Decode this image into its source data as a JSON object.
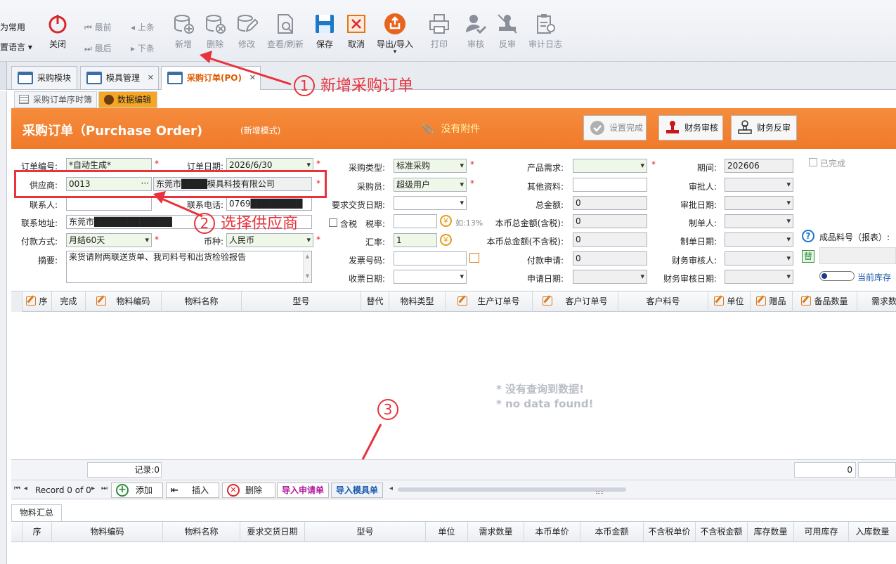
{
  "toolbar": {
    "left_top": "为常用",
    "left_bottom": "置语言",
    "close": "关闭",
    "first": "最前",
    "last": "最后",
    "prev": "上条",
    "next": "下条",
    "add": "新增",
    "delete": "删除",
    "edit": "修改",
    "view_refresh": "查看/刷新",
    "save": "保存",
    "cancel": "取消",
    "export_import": "导出/导入",
    "print": "打印",
    "audit": "审核",
    "unaudit": "反审",
    "audit_log": "审计日志"
  },
  "tabs": [
    {
      "label": "采购模块"
    },
    {
      "label": "模具管理"
    },
    {
      "label": "采购订单(PO)"
    }
  ],
  "subtabs": [
    {
      "label": "采购订单序时簿"
    },
    {
      "label": "数据编辑"
    }
  ],
  "header": {
    "title": "采购订单（Purchase Order)",
    "mode": "(新增模式)",
    "attachment": "没有附件",
    "set_done": "设置完成",
    "fin_audit": "财务审核",
    "fin_unaudit": "财务反审"
  },
  "form": {
    "order_no_label": "订单编号:",
    "order_no": "*自动生成*",
    "order_date_label": "订单日期:",
    "order_date": "2026/6/30",
    "supplier_label": "供应商:",
    "supplier_code": "0013",
    "supplier_name": "东莞市████模具科技有限公司",
    "contact_label": "联系人:",
    "phone_label": "联系电话:",
    "phone": "0769████████",
    "address_label": "联系地址:",
    "address": "东莞市████████████",
    "pay_label": "付款方式:",
    "pay": "月结60天",
    "currency_label": "币种:",
    "currency": "人民币",
    "memo_label": "摘要:",
    "memo": "来货请附两联送货单、我司料号和出货检验报告",
    "ptype_label": "采购类型:",
    "ptype": "标准采购",
    "buyer_label": "采购员:",
    "buyer": "超级用户",
    "delivery_label": "要求交货日期:",
    "tax_incl": "含税",
    "tax_rate_label": "税率:",
    "tax_hint": "如:13%",
    "rate_label": "汇率:",
    "rate": "1",
    "invoice_label": "发票号码:",
    "receipt_label": "收票日期:",
    "demand_label": "产品需求:",
    "other_label": "其他资料:",
    "total_label": "总金额:",
    "total": "0",
    "total_tax_label": "本币总金额(含税):",
    "total_tax": "0",
    "total_notax_label": "本币总金额(不含税):",
    "total_notax": "0",
    "payreq_label": "付款申请:",
    "payreq": "0",
    "apply_date_label": "申请日期:",
    "period_label": "期间:",
    "period": "202606",
    "approver_label": "审批人:",
    "approve_date_label": "审批日期:",
    "maker_label": "制单人:",
    "make_date_label": "制单日期:",
    "fin_auditor_label": "财务审核人:",
    "fin_audit_date_label": "财务审核日期:",
    "completed": "已完成",
    "fg_label": "成品料号（报表）:",
    "replace": "替",
    "stock": "当前库存"
  },
  "grid1": {
    "cols": [
      "序",
      "完成",
      "物料编码",
      "物料名称",
      "型号",
      "替代",
      "物料类型",
      "生产订单号",
      "客户订单号",
      "客户料号",
      "单位",
      "赠品",
      "备品数量",
      "需求数"
    ],
    "nodata1": "* 没有查询到数据!",
    "nodata2": "* no data found!",
    "records": "记录:0",
    "sum": "0"
  },
  "navbar": {
    "record": "Record 0 of 0",
    "add": "添加",
    "insert": "插入",
    "remove": "删除",
    "import_req": "导入申请单",
    "import_mold": "导入模具单"
  },
  "summary": {
    "tab": "物料汇总",
    "cols": [
      "序",
      "物料编码",
      "物料名称",
      "要求交货日期",
      "型号",
      "单位",
      "需求数量",
      "本币单价",
      "本币金额",
      "不含税单价",
      "不含税金额",
      "库存数量",
      "可用库存",
      "入库数量"
    ]
  },
  "annotations": {
    "a1_num": "1",
    "a1_text": "新增采购订单",
    "a2_num": "2",
    "a2_text": "选择供应商",
    "a3_num": "3"
  },
  "colors": {
    "accent": "#f07a2a",
    "annotation": "#e8323c",
    "nav_tab": "#e05a00"
  }
}
